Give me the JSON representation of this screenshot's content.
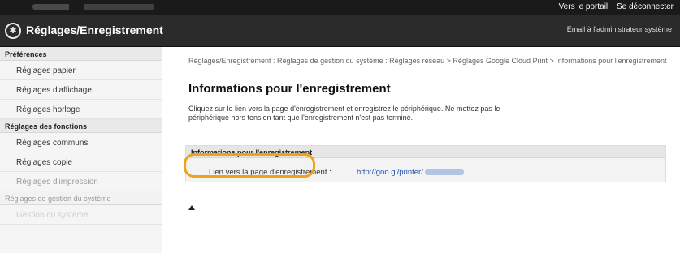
{
  "topbar": {
    "portal_link": "Vers le portail",
    "logout_link": "Se déconnecter"
  },
  "header": {
    "title": "Réglages/Enregistrement",
    "admin_email": "Email à l'administrateur système"
  },
  "sidebar": {
    "sections": [
      {
        "heading": "Préférences",
        "items": [
          "Réglages papier",
          "Réglages d'affichage",
          "Réglages horloge"
        ]
      },
      {
        "heading": "Réglages des fonctions",
        "items": [
          "Réglages communs",
          "Réglages copie",
          "Réglages d'impression"
        ]
      },
      {
        "heading": "Réglages de gestion du système",
        "items": [
          "Gestion du système"
        ]
      }
    ]
  },
  "main": {
    "breadcrumb": "Réglages/Enregistrement : Réglages de gestion du système : Réglages réseau > Réglages Google Cloud Print > Informations pour l'enregistrement",
    "title": "Informations pour l'enregistrement",
    "description": "Cliquez sur le lien vers la page d'enregistrement et enregistrez le périphérique. Ne mettez pas le périphérique hors tension tant que l'enregistrement n'est pas terminé.",
    "box_heading": "Informations pour l'enregistrement",
    "link_label": "Lien vers la page d'enregistrement :",
    "link_value": "http://goo.gl/printer/",
    "highlight_color": "#f0a21b",
    "link_color": "#1f4fb0"
  }
}
